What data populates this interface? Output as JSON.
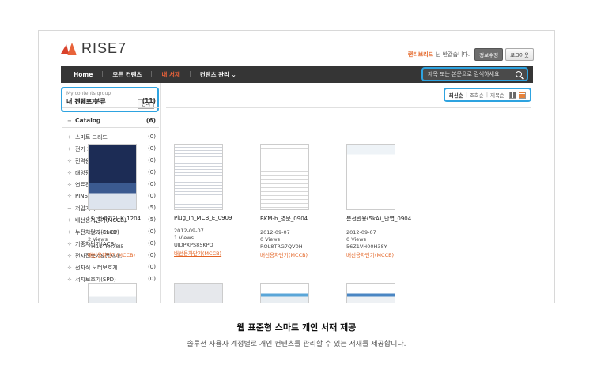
{
  "header": {
    "logo_text": "RISE7",
    "user_name": "랜티브리드",
    "greeting": "님 반갑습니다.",
    "edit_info_label": "정보수정",
    "logout_label": "로그아웃"
  },
  "nav": {
    "items": [
      {
        "label": "Home"
      },
      {
        "label": "모든 컨텐츠"
      },
      {
        "label": "내 서재"
      },
      {
        "label": "컨텐츠 관리 ⌄"
      }
    ],
    "active_color": "#e9623a"
  },
  "search": {
    "placeholder": "제목 또는 본문으로 검색하세요"
  },
  "sidebar": {
    "group_sub": "My contents group",
    "group_title": "내 컨텐츠 분류",
    "manage_label": "관리",
    "rows": [
      {
        "glyph": "+",
        "label": "전체보기",
        "count": "(11)",
        "bold": true
      },
      {
        "glyph": "−",
        "label": "Catalog",
        "count": "(6)",
        "bold": true
      },
      {
        "glyph": "✧",
        "label": "스마트 그리드",
        "count": "(0)"
      },
      {
        "glyph": "✧",
        "label": "전기 자동차 솔루션",
        "count": "(0)"
      },
      {
        "glyph": "✧",
        "label": "전력용 반도체",
        "count": "(0)"
      },
      {
        "glyph": "✧",
        "label": "태양광발전시스템",
        "count": "(0)"
      },
      {
        "glyph": "✧",
        "label": "연료전지",
        "count": "(0)"
      },
      {
        "glyph": "✧",
        "label": "PINS",
        "count": "(0)"
      },
      {
        "glyph": "−",
        "label": "저압기기",
        "count": "(5)"
      },
      {
        "glyph": "✧",
        "label": "배선용차단기(MCCB)",
        "count": "(5)"
      },
      {
        "glyph": "✧",
        "label": "누전차단기(ELCB)",
        "count": "(0)"
      },
      {
        "glyph": "✧",
        "label": "기중차단기(ACB)",
        "count": "(0)"
      },
      {
        "glyph": "✧",
        "label": "전자접촉기&전자개..",
        "count": "(0)"
      },
      {
        "glyph": "✧",
        "label": "전자식 모터보호계..",
        "count": "(0)"
      },
      {
        "glyph": "✧",
        "label": "서지보호기(SPD)",
        "count": "(0)"
      }
    ]
  },
  "sort": {
    "options": [
      "최신순",
      "조회순",
      "제목순"
    ],
    "selected": "최신순"
  },
  "cards": [
    {
      "title": "LS_전력기기_K_1204",
      "date": "2012-09-07",
      "views": "2 Views",
      "code": "7I411TFH78I5",
      "tag": "배선용차단기(MCCB)"
    },
    {
      "title": "Plug_In_MCB_E_0909",
      "date": "2012-09-07",
      "views": "1 Views",
      "code": "UIDPXPS85KPQ",
      "tag": "배선용차단기(MCCB)"
    },
    {
      "title": "BKM-b_영문_0904",
      "date": "2012-09-07",
      "views": "0 Views",
      "code": "ROL8TRG7QV0H",
      "tag": "배선용차단기(MCCB)"
    },
    {
      "title": "분전반용(5kA)_단엽_0904",
      "date": "2012-09-07",
      "views": "0 Views",
      "code": "56Z1VH00H38Y",
      "tag": "배선용차단기(MCCB)"
    }
  ],
  "caption": {
    "title": "웹 표준형 스마트 개인 서재 제공",
    "subtitle": "솔루션 사용자 계정별로 개인 컨텐츠를 관리할 수 있는 서재를 제공합니다."
  },
  "colors": {
    "accent_blue": "#2ea3e0",
    "brand_orange": "#e36424",
    "nav_bg": "#353535"
  }
}
